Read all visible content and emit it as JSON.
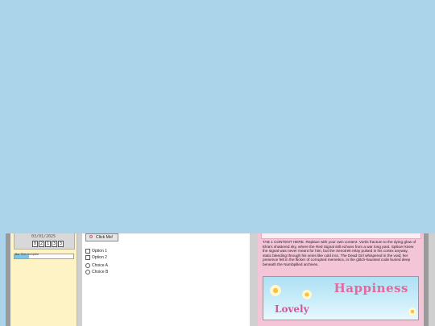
{
  "sidebar": {
    "date": "03/01/2025",
    "counter_digits": [
      "0",
      "2",
      "1",
      "3",
      "3"
    ],
    "progress": {
      "label": "Bar 75% Complete",
      "value": 0.25
    }
  },
  "main": {
    "button_label": "Click Me!",
    "checkboxes": [
      "Option 1",
      "Option 2"
    ],
    "radios": [
      "Choice A",
      "Choice B"
    ]
  },
  "content": {
    "tab_text": "TAB 1 CONTENT HERE. Replace with your own content. Vortis fractum to the dying glow of Elria's shattered sky, where the Red Signal still echoes from a war long past. Spliicer knew the signal was never meant for him, but the Xenotrek relay pulsed in his cortex anyway, static bleeding through his veins like cold iron. The Dead Girl whispered in the void; her presence felt in the flicker of corrupted memetics, in the glitch-haunted code buried deep beneath the Numbpilled archives.",
    "banner": {
      "word1": "Happiness",
      "word2": "Lovely"
    }
  }
}
